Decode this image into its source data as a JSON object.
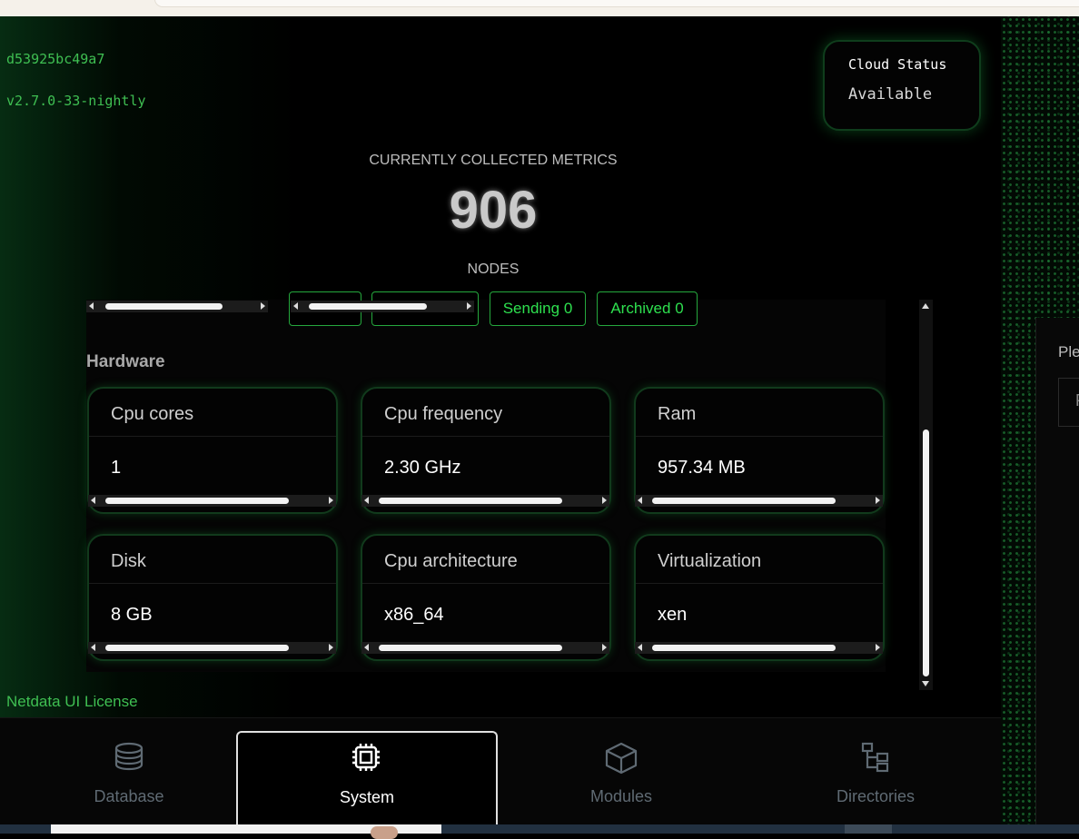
{
  "agent": {
    "id": "d53925bc49a7",
    "version": "v2.7.0-33-nightly"
  },
  "cloud_status": {
    "title": "Cloud Status",
    "value": "Available"
  },
  "metrics": {
    "label": "CURRENTLY COLLECTED METRICS",
    "value": "906",
    "nodes_label": "NODES"
  },
  "node_counters": [
    {
      "label": "Sending 0"
    },
    {
      "label": "Archived 0"
    }
  ],
  "hardware": {
    "heading": "Hardware",
    "cards": [
      {
        "label": "Cpu cores",
        "value": "1"
      },
      {
        "label": "Cpu frequency",
        "value": "2.30 GHz"
      },
      {
        "label": "Ram",
        "value": "957.34 MB"
      },
      {
        "label": "Disk",
        "value": "8 GB"
      },
      {
        "label": "Cpu architecture",
        "value": "x86_64"
      },
      {
        "label": "Virtualization",
        "value": "xen"
      }
    ]
  },
  "license_link": "Netdata UI License",
  "tabs": [
    {
      "label": "Database",
      "icon": "database-icon",
      "active": false
    },
    {
      "label": "System",
      "icon": "cpu-chip-icon",
      "active": true
    },
    {
      "label": "Modules",
      "icon": "cube-icon",
      "active": false
    },
    {
      "label": "Directories",
      "icon": "folder-tree-icon",
      "active": false
    }
  ],
  "side_panel": {
    "text": "Ple",
    "box_text": "P"
  },
  "colors": {
    "accent_green": "#2ee04f",
    "muted_green": "#3fbf52",
    "background": "#000000"
  }
}
